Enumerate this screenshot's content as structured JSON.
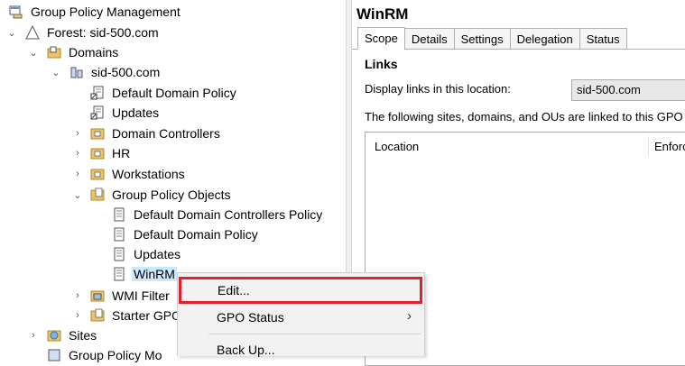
{
  "tree": {
    "root": "Group Policy Management",
    "forest": "Forest: sid-500.com",
    "domains": "Domains",
    "domain": "sid-500.com",
    "items": {
      "ddp": "Default Domain Policy",
      "updates": "Updates",
      "dc": "Domain Controllers",
      "hr": "HR",
      "ws": "Workstations",
      "gpo": "Group Policy Objects",
      "gpo_ddcp": "Default Domain Controllers Policy",
      "gpo_ddp": "Default Domain Policy",
      "gpo_updates": "Updates",
      "gpo_winrm": "WinRM",
      "wmi": "WMI Filter",
      "starter": "Starter GPO",
      "sites": "Sites",
      "gpm": "Group Policy Mo"
    }
  },
  "panel": {
    "title": "WinRM",
    "tabs": [
      "Scope",
      "Details",
      "Settings",
      "Delegation",
      "Status"
    ],
    "links_header": "Links",
    "display_label": "Display links in this location:",
    "location_value": "sid-500.com",
    "following_text": "The following sites, domains, and OUs are linked to this GPO",
    "col_location": "Location",
    "col_enforced": "Enforced"
  },
  "context_menu": {
    "edit": "Edit...",
    "gpo_status": "GPO Status",
    "backup": "Back Up...",
    "submenu_arrow": "›"
  },
  "colors": {
    "highlight": "#e0222e",
    "selection": "#cce8ff"
  }
}
